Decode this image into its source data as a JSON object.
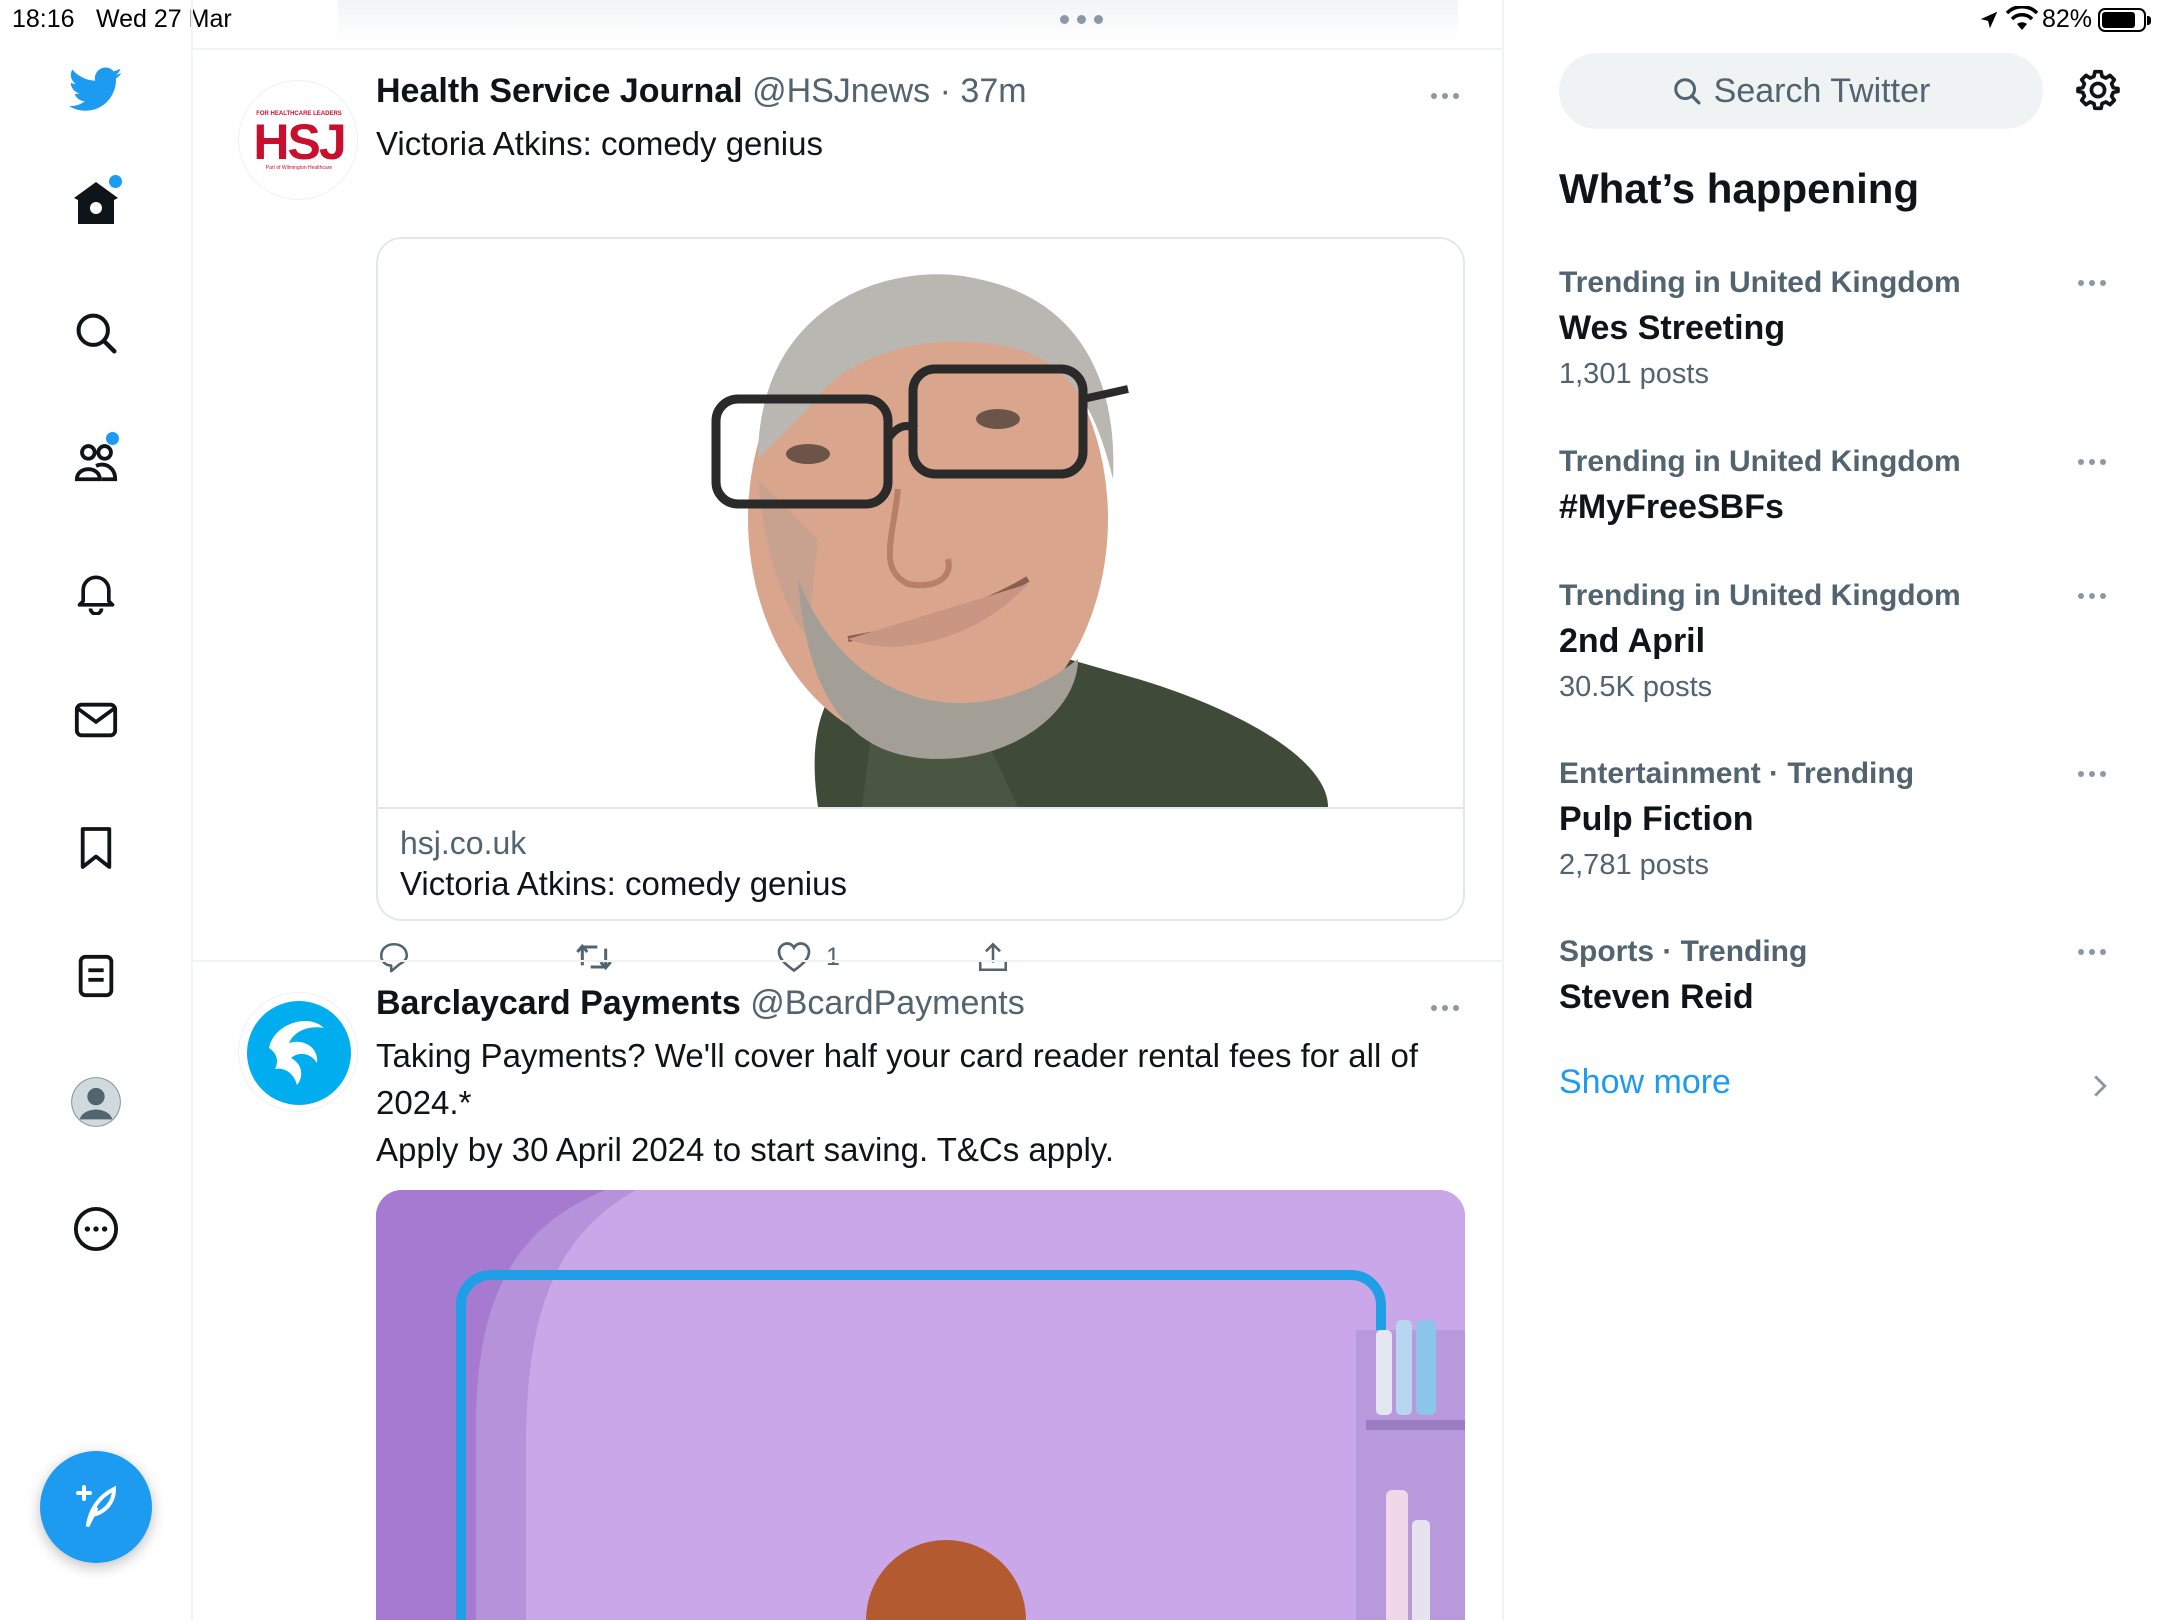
{
  "status_bar": {
    "time": "18:16",
    "date": "Wed 27 Mar",
    "battery_label": "82%",
    "battery_level": 0.82
  },
  "nav": {
    "items": [
      "home-icon",
      "search-icon",
      "communities-icon",
      "notifications-icon",
      "messages-icon",
      "bookmarks-icon",
      "lists-icon",
      "profile-icon",
      "more-icon"
    ],
    "accent_color": "#1d9bf0"
  },
  "tweets": [
    {
      "name": "Health Service Journal",
      "handle": "@HSJnews",
      "time": "· 37m",
      "avatar_text": "HSJ",
      "avatar_small_top": "FOR HEALTHCARE LEADERS",
      "avatar_small_bottom": "Part of Wilmington Healthcare",
      "text": "Victoria Atkins: comedy genius",
      "card": {
        "domain": "hsj.co.uk",
        "title": "Victoria Atkins: comedy genius"
      },
      "likes": "1"
    },
    {
      "name": "Barclaycard Payments",
      "handle": "@BcardPayments",
      "text_line1": "Taking Payments? We'll cover half your card reader rental fees for all of 2024.*",
      "text_line2": "Apply by 30 April 2024 to start saving. T&Cs apply."
    }
  ],
  "sidebar": {
    "search_placeholder": "Search Twitter",
    "section_title": "What’s happening",
    "trends": [
      {
        "context": "Trending in United Kingdom",
        "title": "Wes Streeting",
        "count": "1,301 posts"
      },
      {
        "context": "Trending in United Kingdom",
        "title": "#MyFreeSBFs",
        "count": ""
      },
      {
        "context": "Trending in United Kingdom",
        "title": "2nd April",
        "count": "30.5K posts"
      },
      {
        "context": "Entertainment · Trending",
        "title": "Pulp Fiction",
        "count": "2,781 posts"
      },
      {
        "context": "Sports · Trending",
        "title": "Steven Reid",
        "count": ""
      }
    ],
    "show_more": "Show more"
  }
}
